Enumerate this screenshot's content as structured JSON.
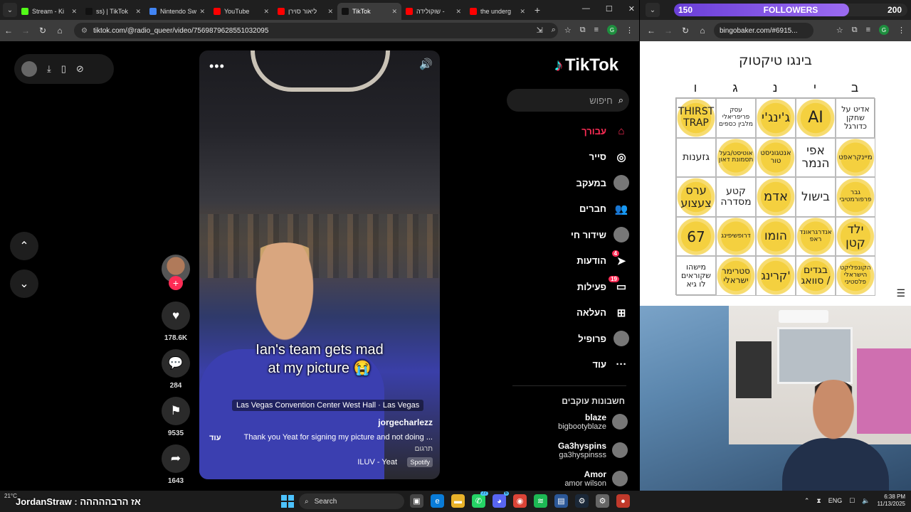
{
  "left_browser": {
    "tabs": [
      {
        "label": "Stream - Ki",
        "color": "#53fc18",
        "active": false
      },
      {
        "label": "ss) | TikTok",
        "color": "#111111",
        "active": false
      },
      {
        "label": "Nintendo Sw",
        "color": "#4285f4",
        "active": false
      },
      {
        "label": "YouTube",
        "color": "#ff0000",
        "active": false
      },
      {
        "label": "ליאור סוירן",
        "color": "#ff0000",
        "active": false
      },
      {
        "label": "TikTok",
        "color": "#111111",
        "active": true
      },
      {
        "label": "שוקולידה -",
        "color": "#ff0000",
        "active": false
      },
      {
        "label": "the underg",
        "color": "#ff0000",
        "active": false
      }
    ],
    "url": "tiktok.com/@radio_queer/video/7569879628551032095"
  },
  "tiktok": {
    "logo": "TikTok",
    "search_placeholder": "חיפוש",
    "nav": [
      {
        "label": "עבורך",
        "icon": "home-icon",
        "glyph": "⌂",
        "active": true,
        "badge": ""
      },
      {
        "label": "סייר",
        "icon": "compass-icon",
        "glyph": "◎",
        "active": false,
        "badge": ""
      },
      {
        "label": "במעקב",
        "icon": "following-avatar-icon",
        "glyph": "",
        "active": false,
        "badge": ""
      },
      {
        "label": "חברים",
        "icon": "friends-icon",
        "glyph": "👥",
        "active": false,
        "badge": ""
      },
      {
        "label": "שידור חי",
        "icon": "live-icon",
        "glyph": "",
        "active": false,
        "badge": ""
      },
      {
        "label": "הודעות",
        "icon": "messages-icon",
        "glyph": "➤",
        "active": false,
        "badge": "4"
      },
      {
        "label": "פעילות",
        "icon": "activity-icon",
        "glyph": "▭",
        "active": false,
        "badge": "19"
      },
      {
        "label": "העלאה",
        "icon": "upload-icon",
        "glyph": "⊞",
        "active": false,
        "badge": ""
      },
      {
        "label": "פרופיל",
        "icon": "profile-avatar-icon",
        "glyph": "",
        "active": false,
        "badge": ""
      },
      {
        "label": "עוד",
        "icon": "more-icon",
        "glyph": "···",
        "active": false,
        "badge": ""
      }
    ],
    "following_title": "חשבונות עוקבים",
    "following": [
      {
        "name": "blaze",
        "handle": "bigbootyblaze"
      },
      {
        "name": "Ga3hyspins",
        "handle": "ga3hyspinsss"
      },
      {
        "name": "Amor",
        "handle": "amor wilson"
      }
    ],
    "video": {
      "caption_line1": "Ian's team gets mad",
      "caption_line2": "at my picture 😭",
      "location": "Las Vegas Convention Center West Hall · Las Vegas",
      "username": "jorgecharlezz",
      "description": "Thank you Yeat for signing my picture and not doing ...",
      "more_label": "עוד",
      "translate_label": "תרגום",
      "song": "ILUV - Yeat",
      "spotify_label": "Spotify"
    },
    "actions": {
      "likes": "178.6K",
      "comments": "284",
      "saves": "9535",
      "shares": "1643"
    }
  },
  "taskbar": {
    "weather": "21°C",
    "chat_user": "JordanStraw",
    "chat_text": "אז הרבההההה",
    "search_label": "Search",
    "lang": "ENG",
    "time": "6:38 PM",
    "date": "11/13/2025"
  },
  "bingo": {
    "followers_current": "150",
    "followers_label": "FOLLOWERS",
    "followers_goal": "200",
    "followers_progress": 0.75,
    "url": "bingobaker.com/#6915...",
    "title": "בינגו טיקטוק",
    "headers": [
      "ו",
      "ג",
      "נ",
      "י",
      "ב"
    ],
    "cells": [
      {
        "text": "THIRST TRAP",
        "marked": true,
        "size": 14
      },
      {
        "text": "עסק פריפריאלי מלבין כספים",
        "marked": false,
        "size": 9
      },
      {
        "text": "ג'ינג'י",
        "marked": true,
        "size": 18
      },
      {
        "text": "AI",
        "marked": true,
        "size": 22
      },
      {
        "text": "אדיט על שחקן כדורגל",
        "marked": false,
        "size": 11
      },
      {
        "text": "גזענות",
        "marked": false,
        "size": 14
      },
      {
        "text": "אוטיסט/בעל תסמונת דאון",
        "marked": true,
        "size": 9
      },
      {
        "text": "אנטגוניסט טור",
        "marked": true,
        "size": 10
      },
      {
        "text": "אפי הנמר",
        "marked": false,
        "size": 17
      },
      {
        "text": "מיינקראפט",
        "marked": true,
        "size": 10
      },
      {
        "text": "ערס צעצוע",
        "marked": true,
        "size": 16
      },
      {
        "text": "קטע מסדרה",
        "marked": false,
        "size": 14
      },
      {
        "text": "אדמ",
        "marked": true,
        "size": 18
      },
      {
        "text": "בישול",
        "marked": false,
        "size": 17
      },
      {
        "text": "גבר פרפורמטיבי",
        "marked": true,
        "size": 9
      },
      {
        "text": "67",
        "marked": true,
        "size": 20
      },
      {
        "text": "דרופשיפינג",
        "marked": true,
        "size": 9
      },
      {
        "text": "הומו",
        "marked": true,
        "size": 17
      },
      {
        "text": "אנדרגראונד ראפ",
        "marked": true,
        "size": 9
      },
      {
        "text": "ילד קטן",
        "marked": true,
        "size": 17
      },
      {
        "text": "מישהו שקוראים לו גיא",
        "marked": false,
        "size": 11
      },
      {
        "text": "סטרימר ישראלי",
        "marked": true,
        "size": 12
      },
      {
        "text": "קרינג'",
        "marked": true,
        "size": 16
      },
      {
        "text": "בגדים סוואג /",
        "marked": true,
        "size": 14
      },
      {
        "text": "הקונפליקט הישראלי פלסטיני",
        "marked": true,
        "size": 9
      }
    ]
  }
}
